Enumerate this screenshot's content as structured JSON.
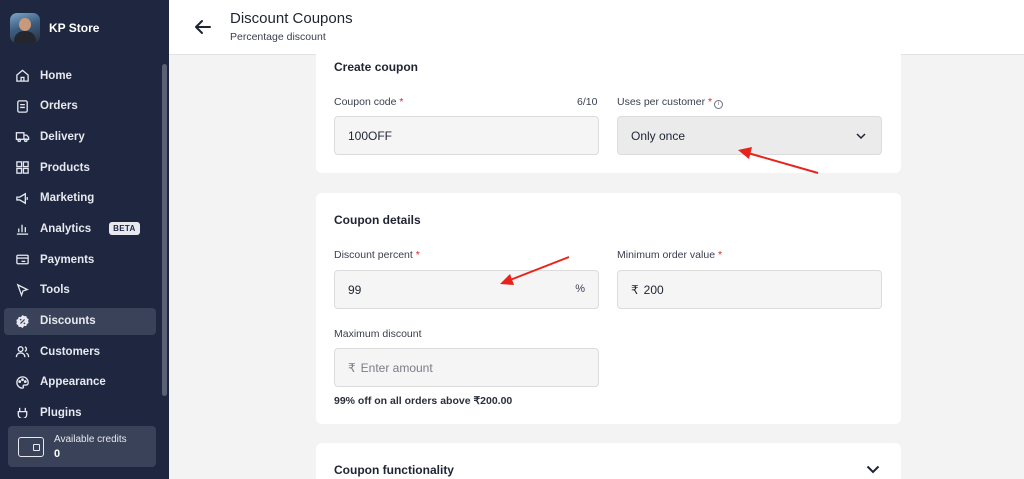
{
  "store": {
    "name": "KP Store"
  },
  "nav": {
    "items": [
      {
        "label": "Home",
        "icon": "home-icon"
      },
      {
        "label": "Orders",
        "icon": "orders-icon"
      },
      {
        "label": "Delivery",
        "icon": "truck-icon"
      },
      {
        "label": "Products",
        "icon": "grid-icon"
      },
      {
        "label": "Marketing",
        "icon": "megaphone-icon"
      },
      {
        "label": "Analytics",
        "icon": "chart-icon",
        "badge": "BETA"
      },
      {
        "label": "Payments",
        "icon": "payments-icon"
      },
      {
        "label": "Tools",
        "icon": "cursor-icon"
      },
      {
        "label": "Discounts",
        "icon": "discount-icon",
        "active": true
      },
      {
        "label": "Customers",
        "icon": "users-icon"
      },
      {
        "label": "Appearance",
        "icon": "palette-icon"
      },
      {
        "label": "Plugins",
        "icon": "plug-icon"
      }
    ]
  },
  "credits": {
    "label": "Available credits",
    "value": "0"
  },
  "header": {
    "title": "Discount Coupons",
    "subtitle": "Percentage discount"
  },
  "create_coupon": {
    "title": "Create coupon",
    "code_label": "Coupon code",
    "code_counter": "6/10",
    "code_value": "100OFF",
    "uses_label": "Uses per customer",
    "uses_value": "Only once"
  },
  "details": {
    "title": "Coupon details",
    "percent_label": "Discount percent",
    "percent_value": "99",
    "percent_suffix": "%",
    "min_label": "Minimum order value",
    "min_currency": "₹",
    "min_value": "200",
    "max_label": "Maximum discount",
    "max_currency": "₹",
    "max_placeholder": "Enter amount",
    "helper": "99% off on all orders above ₹200.00"
  },
  "functionality": {
    "title": "Coupon functionality"
  },
  "colors": {
    "sidebar": "#1e2640",
    "active": "#3a4259",
    "required": "#d3262b",
    "annotation": "#e8231c"
  }
}
